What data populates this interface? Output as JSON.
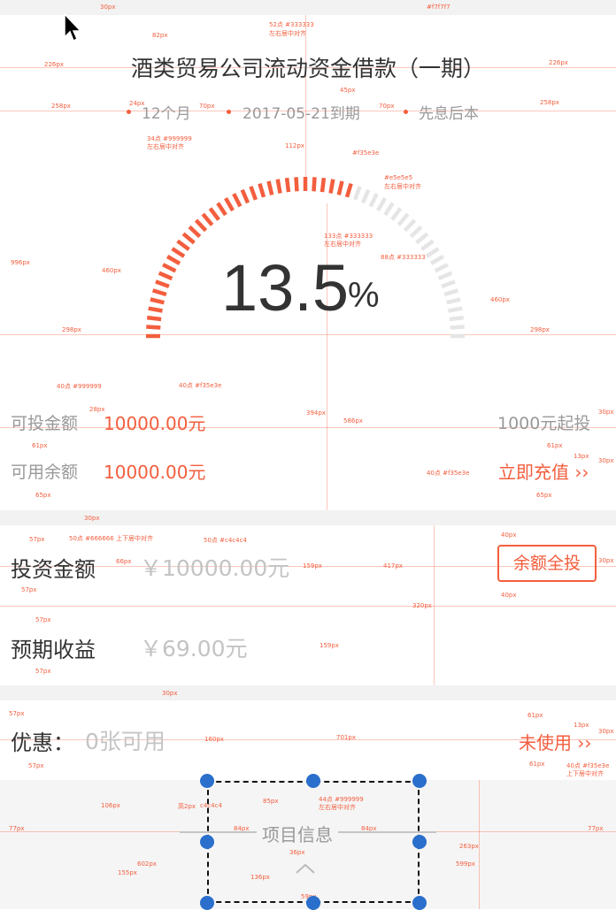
{
  "product": {
    "title": "酒类贸易公司流动资金借款（一期）",
    "term": "12个月",
    "due_date": "2017-05-21到期",
    "repayment": "先息后本",
    "rate_value": "13.5",
    "rate_unit": "%",
    "rate_progress_fraction": 0.6
  },
  "investable": {
    "label": "可投金额",
    "value": "10000.00元",
    "min_note": "1000元起投"
  },
  "balance": {
    "label": "可用余额",
    "value": "10000.00元",
    "recharge_link": "立即充值 ››"
  },
  "investment": {
    "amount_label": "投资金额",
    "amount_placeholder": "￥10000.00元",
    "invest_all_label": "余额全投",
    "expected_label": "预期收益",
    "expected_value": "￥69.00元"
  },
  "discount": {
    "label": "优惠：",
    "available": "0张可用",
    "status_link": "未使用 ››"
  },
  "project_info": {
    "label": "项目信息"
  },
  "annotations": {
    "top_color": "#f7f7f7",
    "a1": "30px",
    "a2": "82px",
    "a3": "52点 #333333",
    "a3b": "左右居中对齐",
    "a4": "226px",
    "a5": "226px",
    "a6": "258px",
    "a7": "258px",
    "a8": "24px",
    "a9": "70px",
    "a10": "45px",
    "a11": "70px",
    "a12": "34点 #999999",
    "a12b": "左右居中对齐",
    "a13": "112px",
    "a14": "#f35e3e",
    "a15": "#e5e5e5",
    "a15b": "左右居中对齐",
    "a16": "133点 #333333",
    "a16b": "左右居中对齐",
    "a17": "88点 #333333",
    "a18": "996px",
    "a19": "460px",
    "a20": "460px",
    "a21": "298px",
    "a22": "298px",
    "a23": "40点 #999999",
    "a24": "40点 #f35e3e",
    "a25": "28px",
    "a26": "394px",
    "a27": "586px",
    "a28": "30px",
    "a29": "61px",
    "a30": "61px",
    "a31": "13px",
    "a32": "30px",
    "a33": "40点 #f35e3e",
    "a34": "65px",
    "a35": "65px",
    "a36": "30px",
    "a37": "57px",
    "a38": "50点 #666666 上下居中对齐",
    "a39": "50点 #c4c4c4",
    "a40": "66px",
    "a41": "159px",
    "a42": "417px",
    "a43": "40px",
    "a44": "30px",
    "a45": "40px",
    "a46": "57px",
    "a47": "320px",
    "a48": "57px",
    "a49": "159px",
    "a50": "57px",
    "a51": "30px",
    "a52": "57px",
    "a53": "160px",
    "a54": "701px",
    "a55": "61px",
    "a56": "13px",
    "a57": "30px",
    "a58": "61px",
    "a59": "40点 #f35e3e",
    "a59b": "上下居中对齐",
    "a60": "57px",
    "a61": "106px",
    "a62": "高2px",
    "a63": "c4c4c4",
    "a64": "85px",
    "a65": "44点 #999999",
    "a65b": "左右居中对齐",
    "a66": "77px",
    "a67": "84px",
    "a68": "84px",
    "a69": "77px",
    "a70": "36px",
    "a71": "263px",
    "a72": "602px",
    "a73": "599px",
    "a74": "155px",
    "a75": "136px",
    "a76": "59px"
  }
}
